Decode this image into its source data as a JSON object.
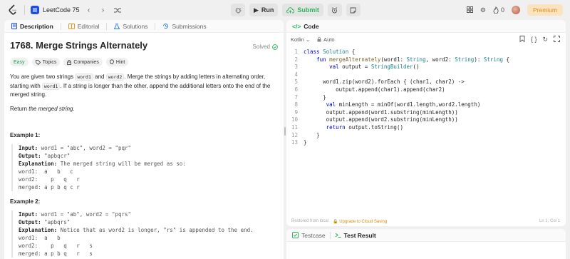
{
  "topbar": {
    "problem_list_label": "LeetCode 75",
    "run_label": "Run",
    "submit_label": "Submit",
    "streak_count": "0",
    "premium_label": "Premium"
  },
  "left_tabs": [
    {
      "label": "Description"
    },
    {
      "label": "Editorial"
    },
    {
      "label": "Solutions"
    },
    {
      "label": "Submissions"
    }
  ],
  "problem": {
    "title": "1768. Merge Strings Alternately",
    "status": "Solved",
    "tags": [
      "Easy",
      "Topics",
      "Companies",
      "Hint"
    ],
    "desc_part1": "You are given two strings ",
    "code1": "word1",
    "desc_part2": " and ",
    "code2": "word2",
    "desc_part3": ". Merge the strings by adding letters in alternating order, starting with ",
    "code3": "word1",
    "desc_part4": ". If a string is longer than the other, append the additional letters onto the end of the merged string.",
    "return_prefix": "Return ",
    "return_em": "the merged string",
    "return_suffix": "."
  },
  "examples": [
    {
      "title": "Example 1:",
      "input_label": "Input:",
      "input": " word1 = \"abc\", word2 = \"pqr\"",
      "output_label": "Output:",
      "output": " \"apbqcr\"",
      "explanation_label": "Explanation:",
      "explanation": " The merged string will be merged as so:",
      "lines": [
        "word1:  a   b   c",
        "word2:    p   q   r",
        "merged: a p b q c r"
      ]
    },
    {
      "title": "Example 2:",
      "input_label": "Input:",
      "input": " word1 = \"ab\", word2 = \"pqrs\"",
      "output_label": "Output:",
      "output": " \"apbqrs\"",
      "explanation_label": "Explanation:",
      "explanation": " Notice that as word2 is longer, \"rs\" is appended to the end.",
      "lines": [
        "word1:  a   b",
        "word2:    p   q   r   s",
        "merged: a p b q   r   s"
      ]
    }
  ],
  "code_panel": {
    "tab_label": "Code",
    "language": "Kotlin",
    "auto_label": "Auto",
    "restored_label": "Restored from local",
    "upgrade_label": "Upgrade to Cloud Saving",
    "cursor_pos": "Ln 1, Col 1"
  },
  "code_lines": [
    "class Solution {",
    "    fun mergeAlternately(word1: String, word2: String): String {",
    "        val output = StringBuilder()",
    "",
    "      word1.zip(word2).forEach { (char1, char2) ->",
    "          output.append(char1).append(char2)",
    "      }",
    "       val minLength = minOf(word1.length,word2.length)",
    "       output.append(word1.substring(minLength))",
    "       output.append(word2.substring(minLength))",
    "       return output.toString()",
    "    }",
    "}"
  ],
  "bottom_tabs": [
    {
      "label": "Testcase"
    },
    {
      "label": "Test Result"
    }
  ],
  "colors": {
    "accent_blue": "#1f4fe0",
    "green": "#2db55d",
    "premium_orange": "#e08c16"
  }
}
